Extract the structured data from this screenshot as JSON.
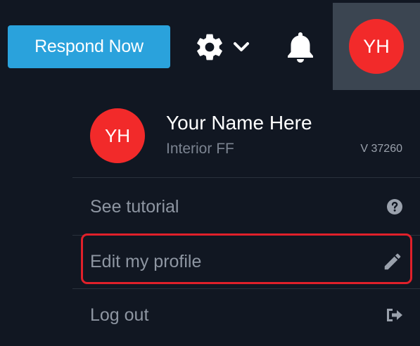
{
  "header": {
    "respond_button_label": "Respond Now",
    "settings_icon": "gear-icon",
    "settings_chevron_icon": "chevron-down-icon",
    "notifications_icon": "bell-icon",
    "avatar_initials": "YH"
  },
  "profile": {
    "initials": "YH",
    "name": "Your Name Here",
    "company": "Interior FF",
    "version": "V 37260"
  },
  "menu": {
    "items": [
      {
        "label": "See tutorial",
        "icon": "question-circle-icon"
      },
      {
        "label": "Edit my profile",
        "icon": "pencil-icon",
        "highlighted": true
      },
      {
        "label": "Log out",
        "icon": "sign-out-icon"
      }
    ]
  },
  "colors": {
    "background": "#111722",
    "accent_button": "#2aa2dc",
    "avatar": "#f22a2a",
    "highlight_border": "#e0202a",
    "avatar_box": "#3b4551"
  }
}
